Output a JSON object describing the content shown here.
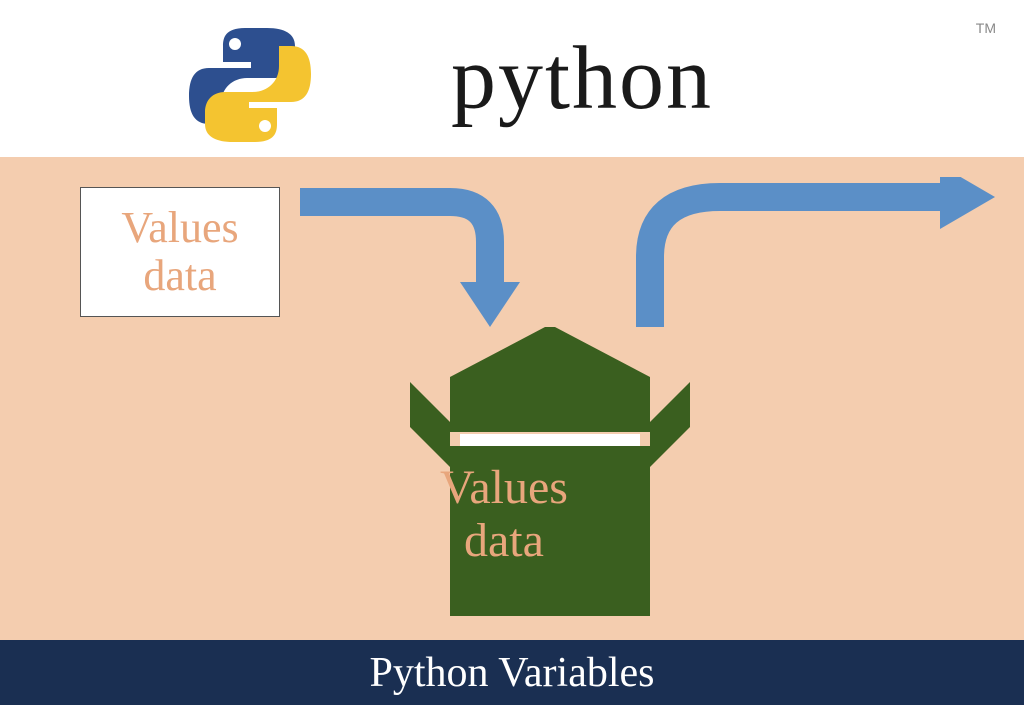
{
  "header": {
    "logo_text": "python",
    "trademark": "TM"
  },
  "diagram": {
    "card_line1": "Values",
    "card_line2": "data",
    "box_line1": "Values",
    "box_line2": "data"
  },
  "footer": {
    "title": "Python Variables"
  },
  "colors": {
    "background": "#f4cdaf",
    "arrow": "#5b8fc7",
    "box": "#3a5f1f",
    "footer": "#1a2f52",
    "accent_text": "#e8a67c",
    "python_blue": "#3572A5",
    "python_yellow": "#FFD43B"
  }
}
